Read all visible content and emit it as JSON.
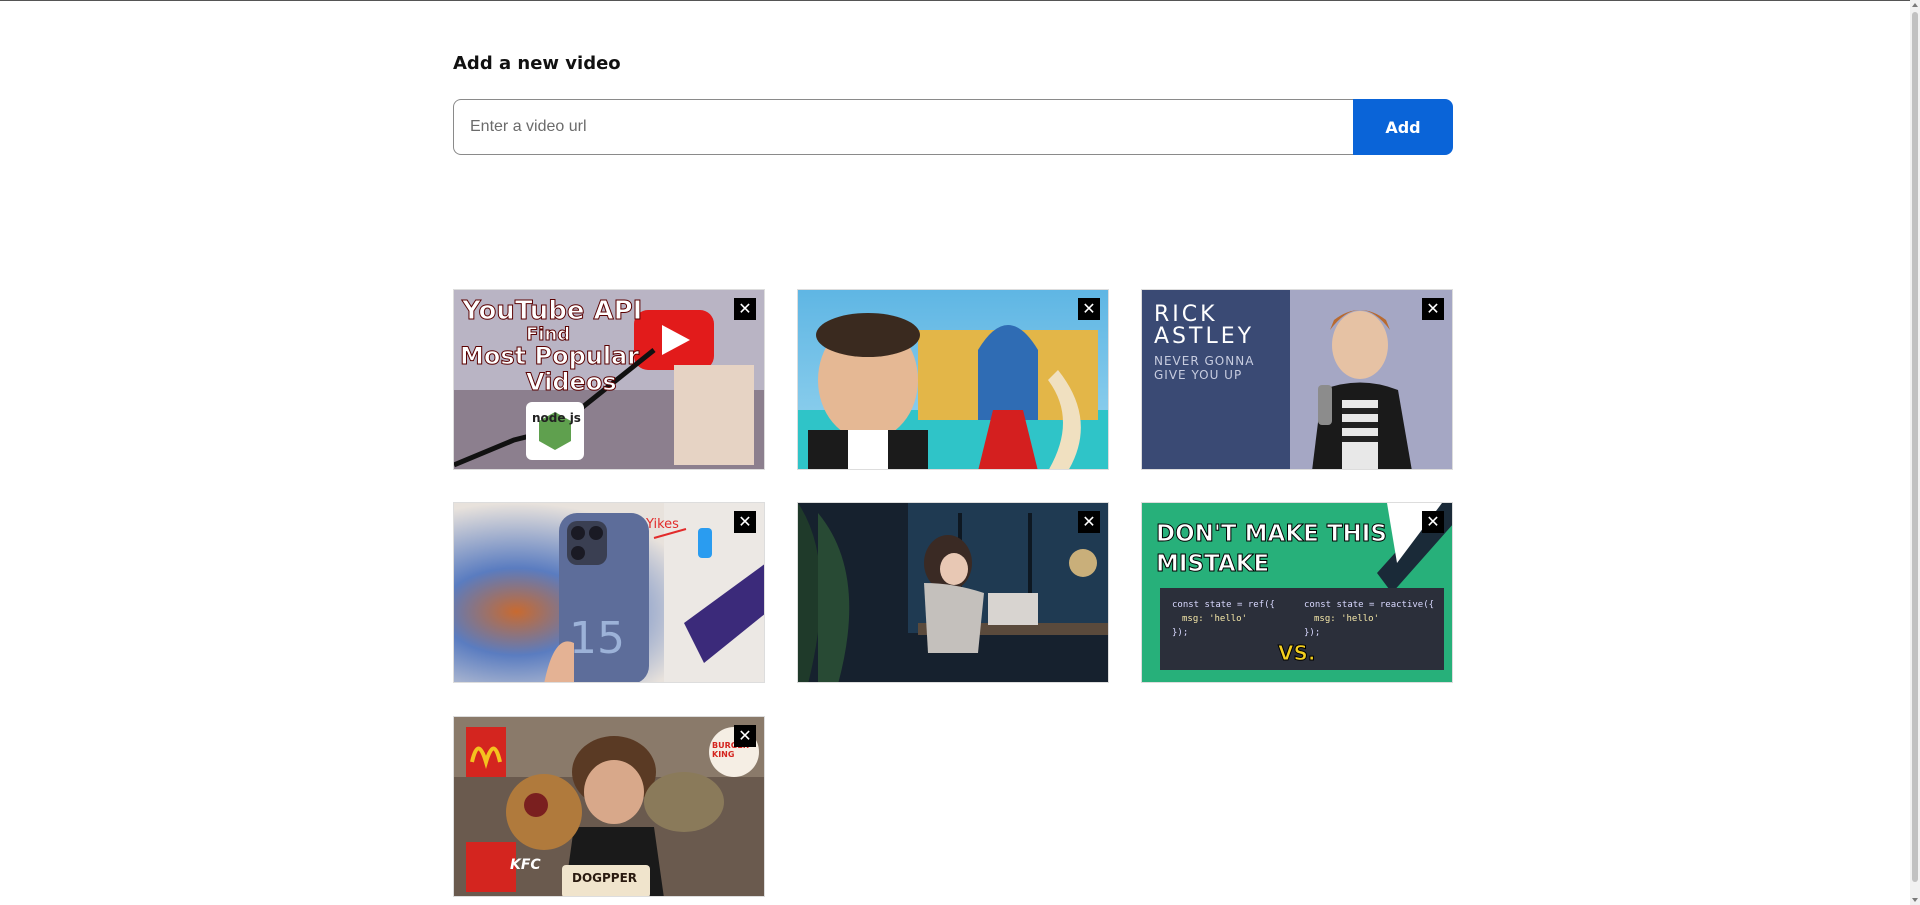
{
  "form": {
    "heading": "Add a new video",
    "placeholder": "Enter a video url",
    "add_label": "Add"
  },
  "colors": {
    "accent": "#0a64d8",
    "close_bg": "#000000"
  },
  "videos": [
    {
      "thumbnail_text": [
        "YouTube API",
        "Find",
        "Most Popular",
        "Videos"
      ],
      "badge": "node js",
      "close_icon": "✕"
    },
    {
      "thumbnail_text": [],
      "close_icon": "✕"
    },
    {
      "thumbnail_text": [
        "RICK",
        "ASTLEY",
        "NEVER GONNA",
        "GIVE YOU UP"
      ],
      "close_icon": "✕"
    },
    {
      "thumbnail_text": [
        "Yikes",
        "15"
      ],
      "close_icon": "✕"
    },
    {
      "thumbnail_text": [],
      "close_icon": "✕"
    },
    {
      "thumbnail_text": [
        "DON'T MAKE THIS",
        "MISTAKE",
        "const state = ref({",
        "msg: 'hello'",
        "});",
        "const state = reactive({",
        "msg: 'hello'",
        "});",
        "VS."
      ],
      "close_icon": "✕"
    },
    {
      "thumbnail_text": [
        "KFC",
        "BURGER KING",
        "DOGPPER"
      ],
      "close_icon": "✕"
    }
  ]
}
